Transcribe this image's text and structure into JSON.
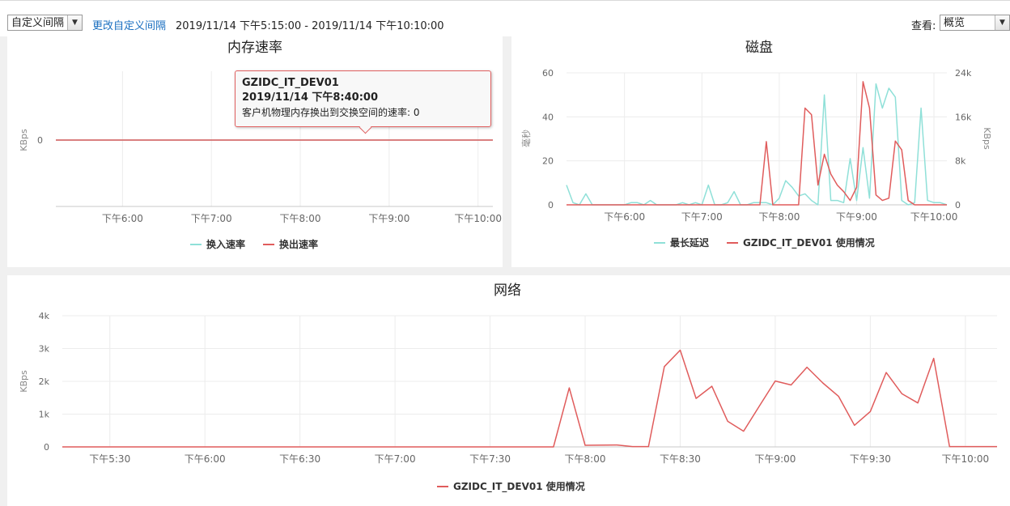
{
  "toolbar": {
    "interval_select": "自定义间隔",
    "change_link": "更改自定义间隔",
    "time_range": "2019/11/14 下午5:15:00 - 2019/11/14 下午10:10:00",
    "view_label": "查看:",
    "view_select": "概览"
  },
  "colors": {
    "red": "#e05c5c",
    "cyan": "#8fe0d8",
    "grid": "#ececec",
    "axis_text": "#666666"
  },
  "memory": {
    "tooltip": {
      "host": "GZIDC_IT_DEV01",
      "time": "2019/11/14 下午8:40:00",
      "metric": "客户机物理内存换出到交换空间的速率: 0"
    }
  },
  "chart_data": [
    {
      "id": "memory",
      "type": "line",
      "title": "内存速率",
      "ylabel": "KBps",
      "yticks": [
        0
      ],
      "ylim": [
        -1,
        1
      ],
      "xlim": [
        0,
        295
      ],
      "xtick_values": [
        45,
        105,
        165,
        225,
        285
      ],
      "xtick_labels": [
        "下午6:00",
        "下午7:00",
        "下午8:00",
        "下午9:00",
        "下午10:00"
      ],
      "series": [
        {
          "name": "换入速率",
          "color": "#8fe0d8",
          "x": [
            0,
            295
          ],
          "values": [
            0,
            0
          ]
        },
        {
          "name": "换出速率",
          "color": "#e05c5c",
          "x": [
            0,
            295
          ],
          "values": [
            0,
            0
          ]
        }
      ],
      "legend": "bottom-center"
    },
    {
      "id": "disk",
      "type": "line",
      "title": "磁盘",
      "ylabel_left": "毫秒",
      "ylabel_right": "KBps",
      "ylim_left": [
        0,
        60
      ],
      "ylim_right": [
        0,
        24000
      ],
      "yticks_left": [
        0,
        20,
        40,
        60
      ],
      "yticks_right_labels": [
        "0",
        "8k",
        "16k",
        "24k"
      ],
      "xlim": [
        0,
        295
      ],
      "xtick_values": [
        45,
        105,
        165,
        225,
        285
      ],
      "xtick_labels": [
        "下午6:00",
        "下午7:00",
        "下午8:00",
        "下午9:00",
        "下午10:00"
      ],
      "series": [
        {
          "name": "最长延迟",
          "color": "#8fe0d8",
          "axis": "left",
          "x": [
            0,
            5,
            10,
            15,
            20,
            25,
            30,
            35,
            40,
            45,
            50,
            55,
            60,
            65,
            70,
            75,
            80,
            85,
            90,
            95,
            100,
            105,
            110,
            115,
            120,
            125,
            130,
            135,
            140,
            145,
            150,
            155,
            160,
            165,
            170,
            175,
            180,
            185,
            190,
            195,
            200,
            205,
            210,
            215,
            220,
            225,
            230,
            235,
            240,
            245,
            250,
            255,
            260,
            265,
            270,
            275,
            280,
            285,
            290,
            295
          ],
          "values": [
            9,
            1,
            0,
            5,
            0,
            0,
            0,
            0,
            0,
            0,
            1,
            1,
            0,
            2,
            0,
            0,
            0,
            0,
            1,
            0,
            1,
            0,
            9,
            0,
            0,
            1,
            6,
            0,
            0,
            1,
            1,
            1,
            0,
            3,
            11,
            8,
            4,
            5,
            2,
            0,
            50,
            2,
            2,
            1,
            21,
            2,
            26,
            3,
            55,
            44,
            53,
            49,
            2,
            0,
            1,
            44,
            2,
            1,
            1,
            0
          ]
        },
        {
          "name": "GZIDC_IT_DEV01 使用情况",
          "color": "#e05c5c",
          "axis": "right",
          "x": [
            0,
            145,
            150,
            155,
            160,
            165,
            170,
            175,
            180,
            185,
            190,
            195,
            200,
            205,
            210,
            215,
            220,
            225,
            230,
            235,
            240,
            245,
            250,
            255,
            260,
            265,
            270,
            275,
            280,
            285,
            290,
            295
          ],
          "values": [
            0,
            0,
            0,
            11500,
            0,
            0,
            0,
            0,
            0,
            17600,
            16400,
            3600,
            9200,
            5600,
            3600,
            2400,
            800,
            3200,
            22400,
            17600,
            1800,
            800,
            1200,
            11600,
            10000,
            800,
            0,
            0,
            0,
            0,
            0,
            0
          ]
        }
      ],
      "legend": "bottom-center"
    },
    {
      "id": "network",
      "type": "line",
      "title": "网络",
      "ylabel": "KBps",
      "ylim": [
        0,
        4000
      ],
      "yticks": [
        0,
        1000,
        2000,
        3000,
        4000
      ],
      "ytick_labels": [
        "0",
        "1k",
        "2k",
        "3k",
        "4k"
      ],
      "xlim": [
        0,
        295
      ],
      "xtick_values": [
        15,
        45,
        75,
        105,
        135,
        165,
        195,
        225,
        255,
        285
      ],
      "xtick_labels": [
        "下午5:30",
        "下午6:00",
        "下午6:30",
        "下午7:00",
        "下午7:30",
        "下午8:00",
        "下午8:30",
        "下午9:00",
        "下午9:30",
        "下午10:00"
      ],
      "series": [
        {
          "name": "GZIDC_IT_DEV01 使用情况",
          "color": "#e05c5c",
          "x": [
            0,
            155,
            160,
            165,
            175,
            180,
            185,
            190,
            195,
            200,
            205,
            210,
            215,
            220,
            225,
            230,
            235,
            240,
            245,
            250,
            255,
            260,
            265,
            270,
            275,
            280,
            285,
            290,
            295
          ],
          "values": [
            0,
            0,
            1800,
            50,
            60,
            10,
            10,
            2450,
            2950,
            1480,
            1850,
            780,
            480,
            1250,
            2010,
            1890,
            2430,
            1950,
            1540,
            660,
            1080,
            2270,
            1620,
            1340,
            2700,
            10,
            10,
            10,
            10
          ]
        }
      ],
      "legend": "bottom-center"
    }
  ]
}
